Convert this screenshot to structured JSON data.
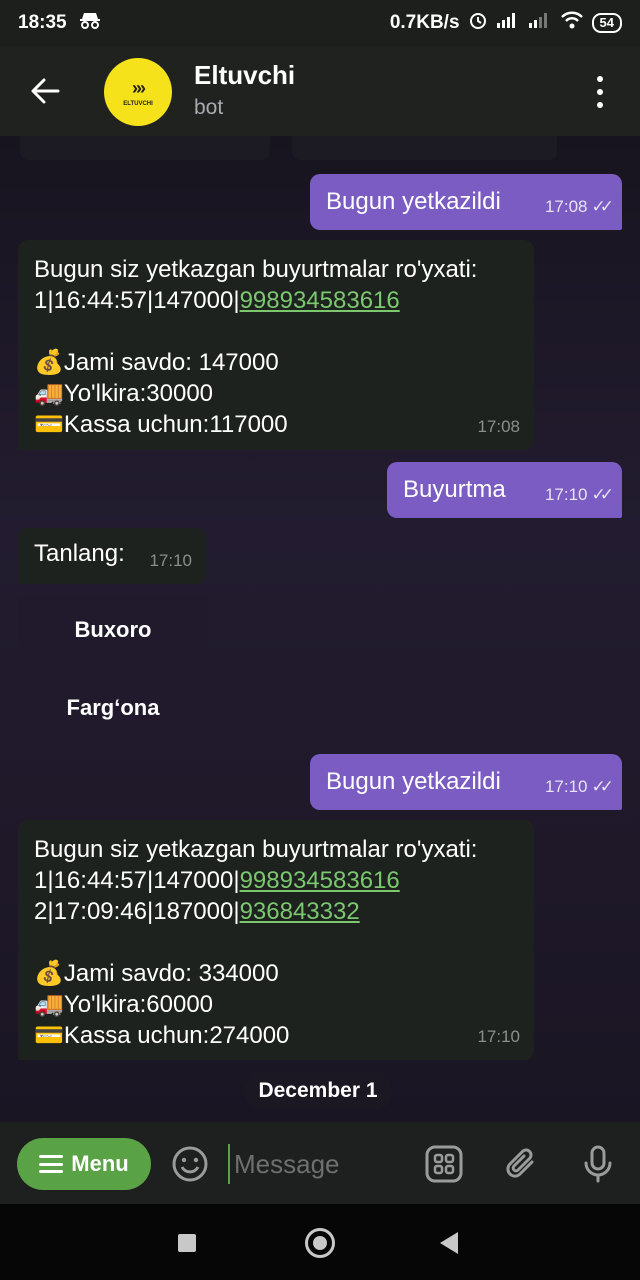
{
  "status_bar": {
    "time": "18:35",
    "speed": "0.7KB/s",
    "battery": "54"
  },
  "header": {
    "title": "Eltuvchi",
    "subtitle": "bot",
    "avatar_text": "ELTUVCHI",
    "avatar_arrows": "›››"
  },
  "messages": [
    {
      "type": "out",
      "text": "Bugun yetkazildi",
      "time": "17:08"
    },
    {
      "type": "in",
      "lines": [
        "Bugun siz yetkazgan buyurtmalar ro'yxati:"
      ],
      "orders": [
        {
          "prefix": "1|16:44:57|147000|",
          "phone": "998934583616"
        }
      ],
      "total": "💰Jami savdo: 147000",
      "delivery": "🚚Yo'lkira:30000",
      "cash": "💳Kassa uchun:117000",
      "time": "17:08"
    },
    {
      "type": "out",
      "text": "Buyurtma",
      "time": "17:10"
    },
    {
      "type": "in",
      "text": "Tanlang:",
      "time": "17:10"
    },
    {
      "type": "out",
      "text": "Bugun yetkazildi",
      "time": "17:10"
    },
    {
      "type": "in",
      "lines": [
        "Bugun siz yetkazgan buyurtmalar ro'yxati:"
      ],
      "orders": [
        {
          "prefix": "1|16:44:57|147000|",
          "phone": "998934583616"
        },
        {
          "prefix": "2|17:09:46|187000|",
          "phone": "936843332"
        }
      ],
      "total": "💰Jami savdo: 334000",
      "delivery": "🚚Yo'lkira:60000",
      "cash": "💳Kassa uchun:274000",
      "time": "17:10"
    }
  ],
  "keyboard": [
    "Buxoro",
    "Farg‘ona"
  ],
  "date_chip": "December 1",
  "input": {
    "menu_label": "Menu",
    "placeholder": "Message"
  },
  "colors": {
    "outgoing_bubble": "#7a5cc2",
    "incoming_bubble": "#1d221f",
    "link": "#7bc86f",
    "menu_button": "#5aa246"
  }
}
